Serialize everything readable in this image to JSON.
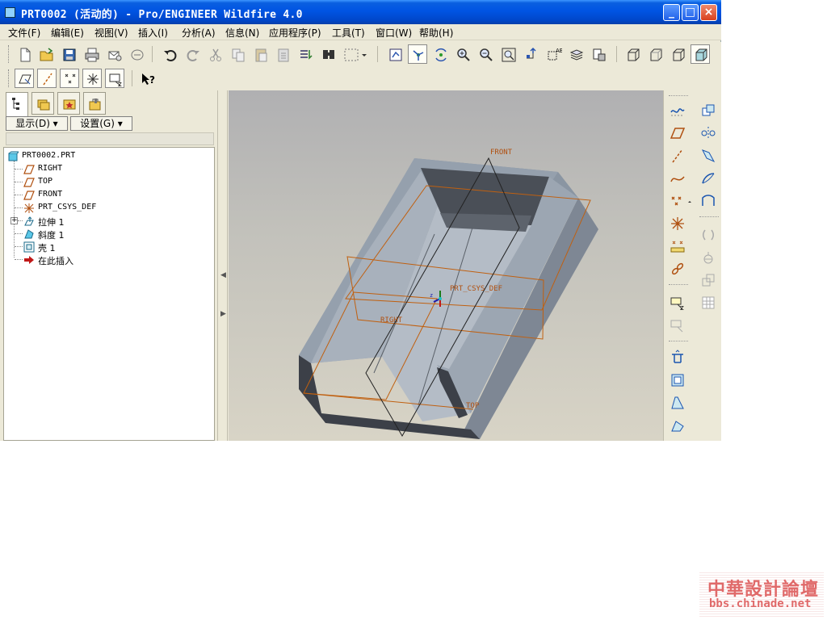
{
  "window": {
    "title": "PRT0002 (活动的) - Pro/ENGINEER Wildfire 4.0",
    "minimize": "_",
    "maximize": "□",
    "close": "×"
  },
  "menu": [
    "文件(F)",
    "编辑(E)",
    "视图(V)",
    "插入(I)",
    "分析(A)",
    "信息(N)",
    "应用程序(P)",
    "工具(T)",
    "窗口(W)",
    "帮助(H)"
  ],
  "panel": {
    "show_button": "显示(D) ▾",
    "settings_button": "设置(G) ▾"
  },
  "tree": [
    {
      "label": "PRT0002.PRT",
      "icon": "part-icon"
    },
    {
      "label": "RIGHT",
      "icon": "datum-plane-icon"
    },
    {
      "label": "TOP",
      "icon": "datum-plane-icon"
    },
    {
      "label": "FRONT",
      "icon": "datum-plane-icon"
    },
    {
      "label": "PRT_CSYS_DEF",
      "icon": "csys-icon"
    },
    {
      "label": "拉伸 1",
      "icon": "extrude-icon"
    },
    {
      "label": "斜度 1",
      "icon": "draft-icon"
    },
    {
      "label": "壳 1",
      "icon": "shell-icon"
    },
    {
      "label": "在此插入",
      "icon": "insert-here-arrow-icon"
    }
  ],
  "viewport": {
    "labels": {
      "front": "FRONT",
      "csys": "PRT_CSYS_DEF",
      "right": "RIGHT",
      "top": "TOP",
      "axis_z": "z"
    }
  },
  "watermark": {
    "cn": "中華設計論壇",
    "url": "bbs.chinade.net"
  },
  "colors": {
    "titlebar": "#0054e3",
    "datum": "#c06010",
    "part_face": "#9ba4b0",
    "viewport_bg": "#c2c1bb"
  }
}
